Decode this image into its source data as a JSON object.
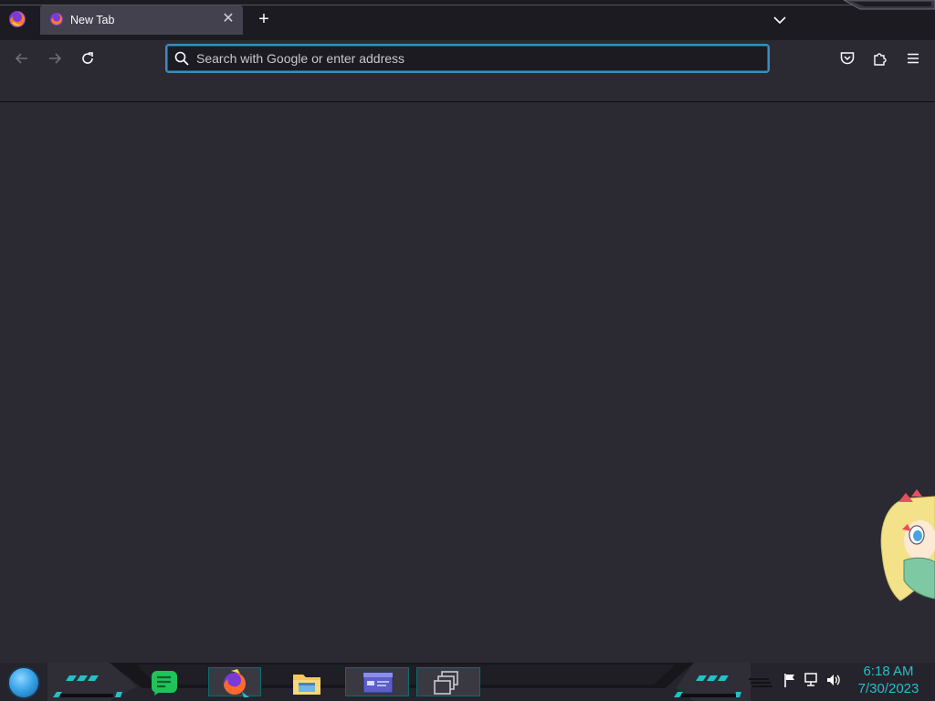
{
  "browser": {
    "tabs": [
      {
        "title": "New Tab",
        "close_symbol": "✕"
      }
    ],
    "new_tab_symbol": "+",
    "toolbar": {
      "back_icon": "arrow-left-icon",
      "forward_icon": "arrow-right-icon",
      "reload_icon": "reload-icon",
      "pocket_icon": "pocket-icon",
      "extensions_icon": "puzzle-piece-icon",
      "menu_icon": "hamburger-menu-icon"
    },
    "urlbar": {
      "placeholder": "Search with Google or enter address",
      "value": ""
    }
  },
  "taskbar": {
    "pinned": [
      {
        "name": "Chat app",
        "icon": "chat-bubble-icon"
      },
      {
        "name": "Firefox",
        "icon": "firefox-icon",
        "active": true
      },
      {
        "name": "File Explorer",
        "icon": "folder-icon"
      },
      {
        "name": "Window app",
        "icon": "window-icon"
      },
      {
        "name": "Task view",
        "icon": "stacked-windows-icon"
      }
    ],
    "tray": {
      "icons": [
        "flag-icon",
        "network-icon",
        "speaker-icon"
      ]
    },
    "clock": {
      "time": "6:18 AM",
      "date": "7/30/2023"
    }
  },
  "colors": {
    "accent_teal": "#22c1c8",
    "urlbar_focus": "#3e8bbd",
    "content_bg": "#2b2a33"
  }
}
